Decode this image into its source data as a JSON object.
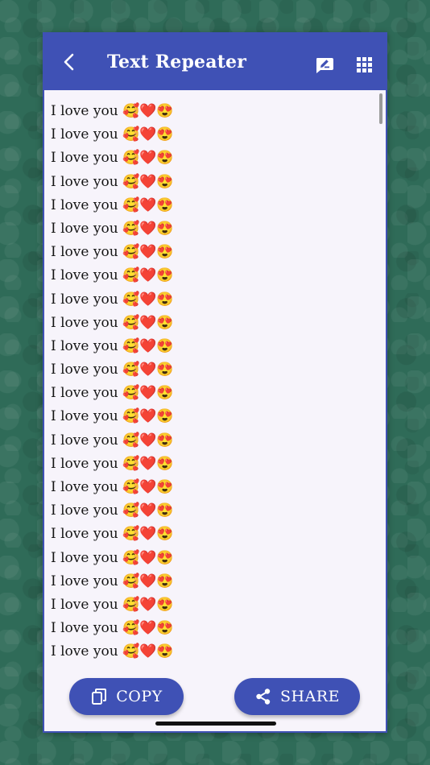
{
  "header": {
    "title": "Text Repeater",
    "back_icon": "back-arrow-icon",
    "edit_icon": "edit-text-icon",
    "menu_icon": "grid-menu-icon"
  },
  "output": {
    "lines": [
      "I love you 🥰❤️😍",
      "I love you 🥰❤️😍",
      "I love you 🥰❤️😍",
      "I love you 🥰❤️😍",
      "I love you 🥰❤️😍",
      "I love you 🥰❤️😍",
      "I love you 🥰❤️😍",
      "I love you 🥰❤️😍",
      "I love you 🥰❤️😍",
      "I love you 🥰❤️😍",
      "I love you 🥰❤️😍",
      "I love you 🥰❤️😍",
      "I love you 🥰❤️😍",
      "I love you 🥰❤️😍",
      "I love you 🥰❤️😍",
      "I love you 🥰❤️😍",
      "I love you 🥰❤️😍",
      "I love you 🥰❤️😍",
      "I love you 🥰❤️😍",
      "I love you 🥰❤️😍",
      "I love you 🥰❤️😍",
      "I love you 🥰❤️😍",
      "I love you 🥰❤️😍",
      "I love you 🥰❤️😍"
    ]
  },
  "actions": {
    "copy_label": "COPY",
    "copy_icon": "copy-icon",
    "share_label": "SHARE",
    "share_icon": "share-icon"
  },
  "colors": {
    "primary": "#3f51b5",
    "background": "#2f6b58",
    "content_bg": "#f7f4fb"
  }
}
